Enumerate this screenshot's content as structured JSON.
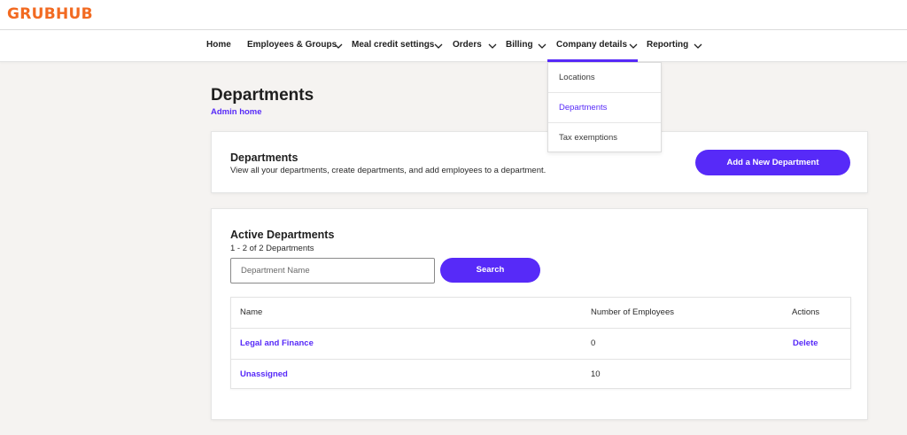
{
  "brand": {
    "logo": "GRUBHUB",
    "accent": "#572af8",
    "logo_color": "#f26a21"
  },
  "nav": {
    "items": [
      {
        "label": "Home",
        "has_chevron": false
      },
      {
        "label": "Employees & Groups",
        "has_chevron": true
      },
      {
        "label": "Meal credit settings",
        "has_chevron": true
      },
      {
        "label": "Orders",
        "has_chevron": true
      },
      {
        "label": "Billing",
        "has_chevron": true
      },
      {
        "label": "Company details",
        "has_chevron": true,
        "active": true
      },
      {
        "label": "Reporting",
        "has_chevron": true
      }
    ],
    "dropdown": {
      "items": [
        {
          "label": "Locations"
        },
        {
          "label": "Departments",
          "active": true
        },
        {
          "label": "Tax exemptions"
        }
      ]
    }
  },
  "page": {
    "title": "Departments",
    "breadcrumb": "Admin home"
  },
  "intro_card": {
    "title": "Departments",
    "description": "View all your departments, create departments, and add employees to a department.",
    "add_button": "Add a New Department"
  },
  "active_card": {
    "title": "Active Departments",
    "count_text": "1 - 2 of 2 Departments",
    "search_placeholder": "Department Name",
    "search_button": "Search",
    "table": {
      "headers": {
        "name": "Name",
        "count": "Number of Employees",
        "actions": "Actions"
      },
      "rows": [
        {
          "name": "Legal and Finance",
          "count": "0",
          "action": "Delete"
        },
        {
          "name": "Unassigned",
          "count": "10",
          "action": ""
        }
      ]
    }
  }
}
